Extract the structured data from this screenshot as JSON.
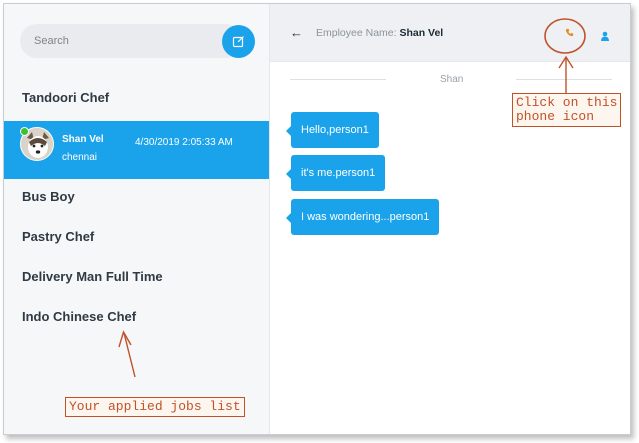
{
  "sidebar": {
    "search_placeholder": "Search",
    "compose_icon": "compose-icon",
    "jobs": [
      {
        "label": "Tandoori Chef"
      },
      {
        "label": "Bus Boy"
      },
      {
        "label": "Pastry Chef"
      },
      {
        "label": "Delivery Man Full Time"
      },
      {
        "label": "Indo Chinese Chef"
      }
    ],
    "active_chat": {
      "name": "Shan Vel",
      "timestamp": "4/30/2019 2:05:33 AM",
      "location": "chennai",
      "avatar_icon": "dog-avatar-icon",
      "status": "online"
    }
  },
  "header": {
    "back_icon": "back-arrow-icon",
    "label_prefix": "Employee Name: ",
    "employee_name": "Shan Vel",
    "phone_icon": "phone-icon",
    "user_icon": "user-icon"
  },
  "chat": {
    "day_label": "Shan",
    "messages": [
      {
        "text": "Hello,person1"
      },
      {
        "text": "it's me.person1"
      },
      {
        "text": "I was wondering...person1"
      }
    ]
  },
  "annotations": {
    "phone_note": "Click on this\nphone icon",
    "jobs_note": "Your applied jobs list"
  },
  "colors": {
    "accent": "#1aa3ea",
    "annotation": "#c0522a",
    "phone": "#e58a22",
    "online": "#3cc12f"
  }
}
